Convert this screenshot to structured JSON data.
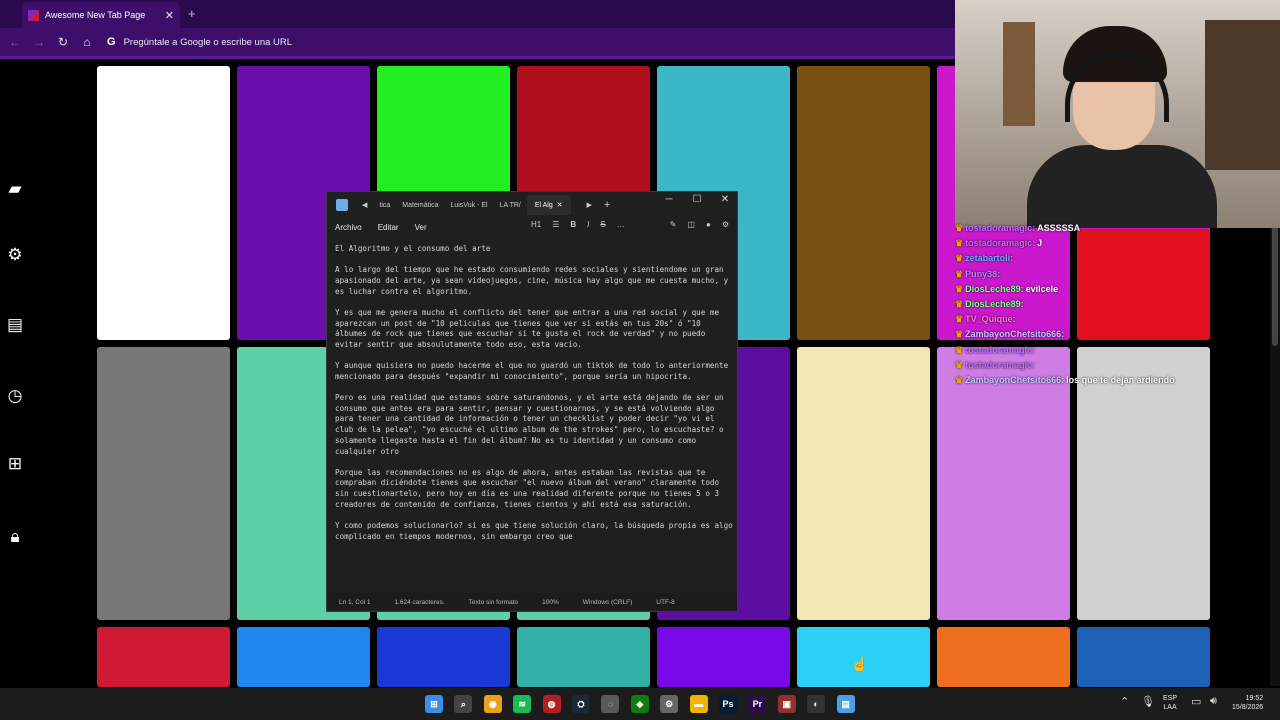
{
  "browser": {
    "tab_title": "Awesome New Tab Page",
    "new_tab_symbol": "+",
    "omnibox_placeholder": "Pregúntale a Google o escribe una URL",
    "nav_icons": [
      "back-icon",
      "forward-icon",
      "reload-icon",
      "home-icon"
    ]
  },
  "sidebar": {
    "icons": [
      "ticket-icon",
      "gear-icon",
      "panel-icon",
      "history-icon",
      "add-icon",
      "lock-icon"
    ]
  },
  "tiles": {
    "colors": [
      [
        "#ffffff",
        "#6a0dad",
        "#22ee22",
        "#b0101e",
        "#3ab7c9",
        "#7a4f12",
        "#cc18cc",
        "#cc18cc"
      ],
      [
        "#777777",
        "#5ccfa6",
        "#5ccfa6",
        "#5ccfa6",
        "#5b0ea0",
        "#f2e6b3",
        "#cf7de5",
        "#d0d0d0"
      ],
      [
        "#d01a34",
        "#1f86f0",
        "#1a39d6",
        "#31b0a8",
        "#7a09ea",
        "#2dd0f5",
        "#ef6f1f",
        "#1e62b8"
      ]
    ],
    "overlay_red": "#e0101c"
  },
  "notepad": {
    "tabs": [
      "tica",
      "Matemática",
      "LuisVuk - El",
      "LA TR/",
      "El Alg"
    ],
    "menu": [
      "Archivo",
      "Editar",
      "Ver"
    ],
    "toolbar": [
      "H1",
      "B",
      "I",
      "S",
      "…"
    ],
    "title_line": "El Algoritmo y el consumo del arte",
    "paragraphs": [
      "A lo largo del tiempo que he estado consumiendo redes sociales y sientiendome un gran apasionado del arte, ya sean videojuegos, cine, música hay algo que me cuesta mucho, y es luchar contra el algoritmo.",
      "Y es que me genera mucho el conflicto del tener que entrar a una red social y que me aparezcan un post de \"10 peliculas que tienes que ver si estás en tus 20s\" ó \"10 álbumes de rock que tienes que escuchar si te gusta el rock de verdad\" y no puedo evitar sentir que absoulutamente todo eso, esta vacío.",
      "Y aunque quisiera no puedo hacerme el que no guardó un tiktok de todo lo anteriormente mencionado para después \"expandir mi conocimiento\", porque sería un hipocrita.",
      "Pero es una realidad que estamos sobre saturandonos, y el arte está dejando de ser un consumo que antes era para sentir, pensar y cuestionarnos, y se está volviendo algo para tener una cantidad de información o tener un checklist y poder decir \"yo vi el club de la pelea\", \"yo escuché el ultimo album de the strokes\" pero, lo escuchaste? o solamente llegaste hasta el fin del álbum? No es tu identidad y un consumo como cualquier otro",
      "Porque las recomendaciones no es algo de ahora, antes estaban las revistas que te compraban diciéndote tienes que escuchar \"el nuevo álbum del verano\" claramente todo sin cuestionartelo, pero hoy en día es una realidad diferente porque no tienes 5 o 3 creadores de contenido de confianza, tienes cientos y ahí está esa saturación.",
      "Y como podemos solucionarlo? si es que tiene solución claro, la búsqueda propia es algo complicado en tiempos modernos, sin embargo creo que"
    ],
    "status": {
      "position": "Ln 1, Col 1",
      "chars": "1.624 caracteres.",
      "format": "Texto sin formato",
      "zoom": "100%",
      "eol": "Windows (CRLF)",
      "encoding": "UTF-8"
    }
  },
  "chat": {
    "lines": [
      {
        "user": "tostadoramagic",
        "msg": "ASSSSSA",
        "color": "#c06bff"
      },
      {
        "user": "tostadoramagic",
        "msg": "J",
        "color": "#c06bff"
      },
      {
        "user": "zetabartoli",
        "msg": "",
        "color": "#6ea8ff"
      },
      {
        "user": "Puny38",
        "msg": "",
        "color": "#b388ff"
      },
      {
        "user": "DiosLeche89",
        "msg": "evilcele",
        "color": "#7cff8a"
      },
      {
        "user": "DiosLeche89",
        "msg": "",
        "color": "#7cff8a"
      },
      {
        "user": "TV_Quique",
        "msg": "",
        "color": "#ff78d0"
      },
      {
        "user": "ZambayonChefsito666",
        "msg": "",
        "color": "#c6c6ff"
      },
      {
        "user": "tostadoramagic",
        "msg": "",
        "color": "#c06bff"
      },
      {
        "user": "tostadoramagic",
        "msg": "",
        "color": "#c06bff"
      },
      {
        "user": "ZambayonChefsito666",
        "msg": "los que te dejan ardiendo",
        "color": "#c6c6ff"
      }
    ]
  },
  "taskbar": {
    "apps": [
      "windows-start-icon",
      "search-icon",
      "chrome-icon",
      "spotify-icon",
      "app-icon",
      "steam-icon",
      "obs-icon",
      "xbox-icon",
      "settings-icon",
      "explorer-icon",
      "photoshop-icon",
      "premiere-icon",
      "app2-icon",
      "capcut-icon",
      "notepad-icon"
    ],
    "lang": "ESP",
    "lang2": "LAA",
    "time": "19:52",
    "date": "15/8/2026"
  }
}
